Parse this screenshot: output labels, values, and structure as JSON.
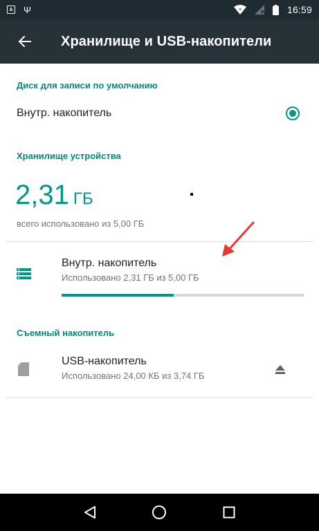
{
  "status_bar": {
    "notification_icon_letter": "A",
    "usb_symbol": "Ψ",
    "time": "16:59"
  },
  "app_bar": {
    "title": "Хранилище и USB-накопители"
  },
  "default_disk": {
    "header": "Диск для записи по умолчанию",
    "option_label": "Внутр. накопитель",
    "selected": true
  },
  "device_storage": {
    "header": "Хранилище устройства",
    "used_value": "2,31",
    "used_unit": "ГБ",
    "used_caption": "всего использовано из 5,00 ГБ",
    "internal": {
      "title": "Внутр. накопитель",
      "summary": "Использовано 2,31 ГБ из 5,00 ГБ",
      "progress_fraction": 0.462
    }
  },
  "removable_storage": {
    "header": "Съемный накопитель",
    "usb": {
      "title": "USB-накопитель",
      "summary": "Использовано 24,00 КБ из 3,74 ГБ"
    }
  },
  "colors": {
    "accent": "#009688",
    "app_bar": "#263238",
    "status_bar": "#1f2b33",
    "annotation_arrow": "#e53935"
  },
  "icons": {
    "back": "arrow-back-icon",
    "radio": "radio-selected-icon",
    "internal_storage": "storage-list-icon",
    "usb_storage": "sd-card-icon",
    "eject": "eject-icon",
    "nav_back": "triangle-back-icon",
    "nav_home": "circle-home-icon",
    "nav_recents": "square-recents-icon"
  }
}
